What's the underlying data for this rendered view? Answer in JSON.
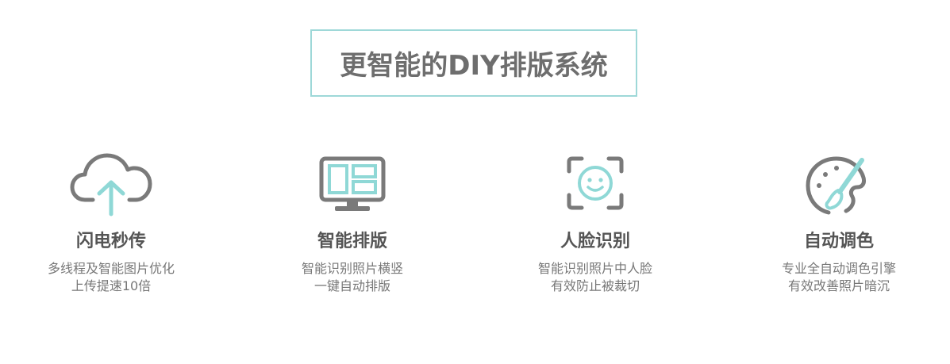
{
  "header": {
    "title": "更智能的DIY排版系统"
  },
  "colors": {
    "accent": "#8fd8d6",
    "icon_gray": "#7a7a7a",
    "title_border": "#9ed8d8",
    "title_text": "#6e6e6e"
  },
  "features": [
    {
      "icon": "cloud-upload-icon",
      "title": "闪电秒传",
      "desc_line1": "多线程及智能图片优化",
      "desc_line2": "上传提速10倍"
    },
    {
      "icon": "monitor-layout-icon",
      "title": "智能排版",
      "desc_line1": "智能识别照片横竖",
      "desc_line2": "一键自动排版"
    },
    {
      "icon": "face-recognition-icon",
      "title": "人脸识别",
      "desc_line1": "智能识别照片中人脸",
      "desc_line2": "有效防止被裁切"
    },
    {
      "icon": "paint-palette-icon",
      "title": "自动调色",
      "desc_line1": "专业全自动调色引擎",
      "desc_line2": "有效改善照片暗沉"
    }
  ]
}
